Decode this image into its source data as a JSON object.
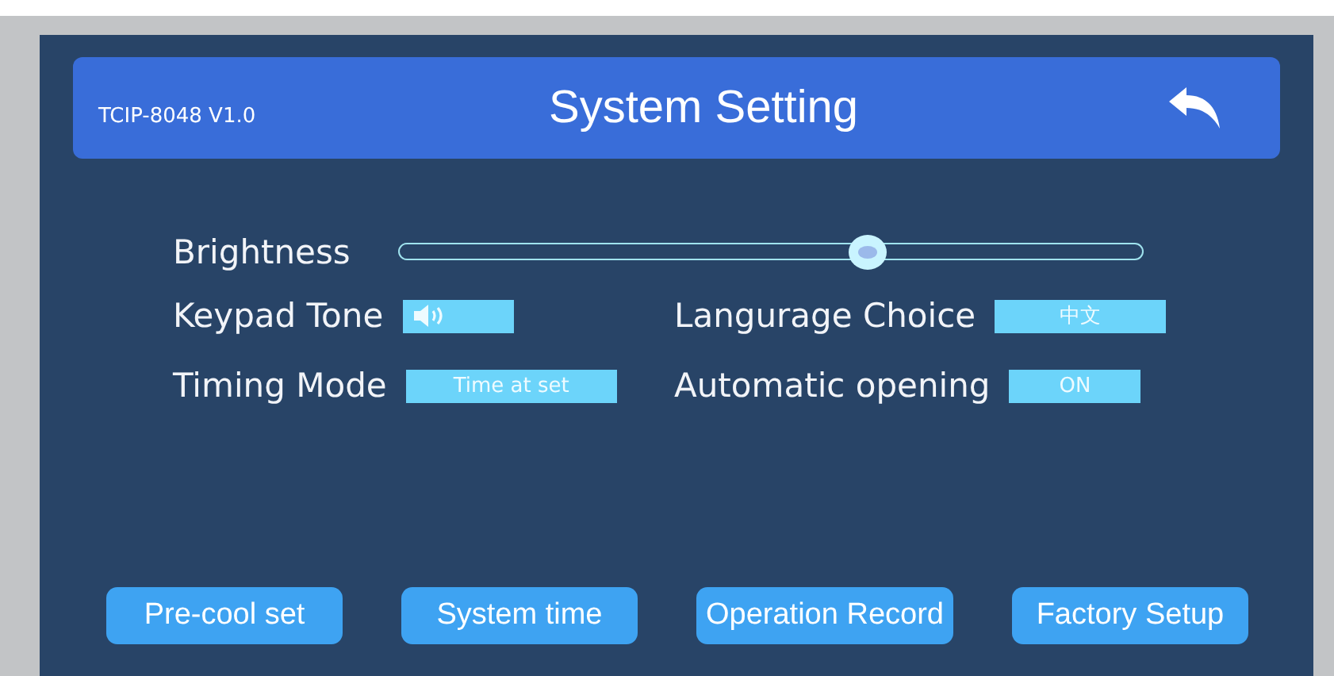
{
  "header": {
    "model": "TCIP-8048 V1.0",
    "title": "System Setting"
  },
  "brightness": {
    "label": "Brightness",
    "level": 0.63
  },
  "settings": [
    {
      "label": "Keypad Tone",
      "kind": "sound"
    },
    {
      "label": "Langurage Choice",
      "kind": "text",
      "value": "中文"
    },
    {
      "label": "Timing Mode",
      "kind": "text",
      "value": "Time at set"
    },
    {
      "label": "Automatic opening",
      "kind": "text",
      "value": "ON"
    }
  ],
  "buttons": [
    "Pre-cool set",
    "System time",
    "Operation Record",
    "Factory Setup"
  ]
}
